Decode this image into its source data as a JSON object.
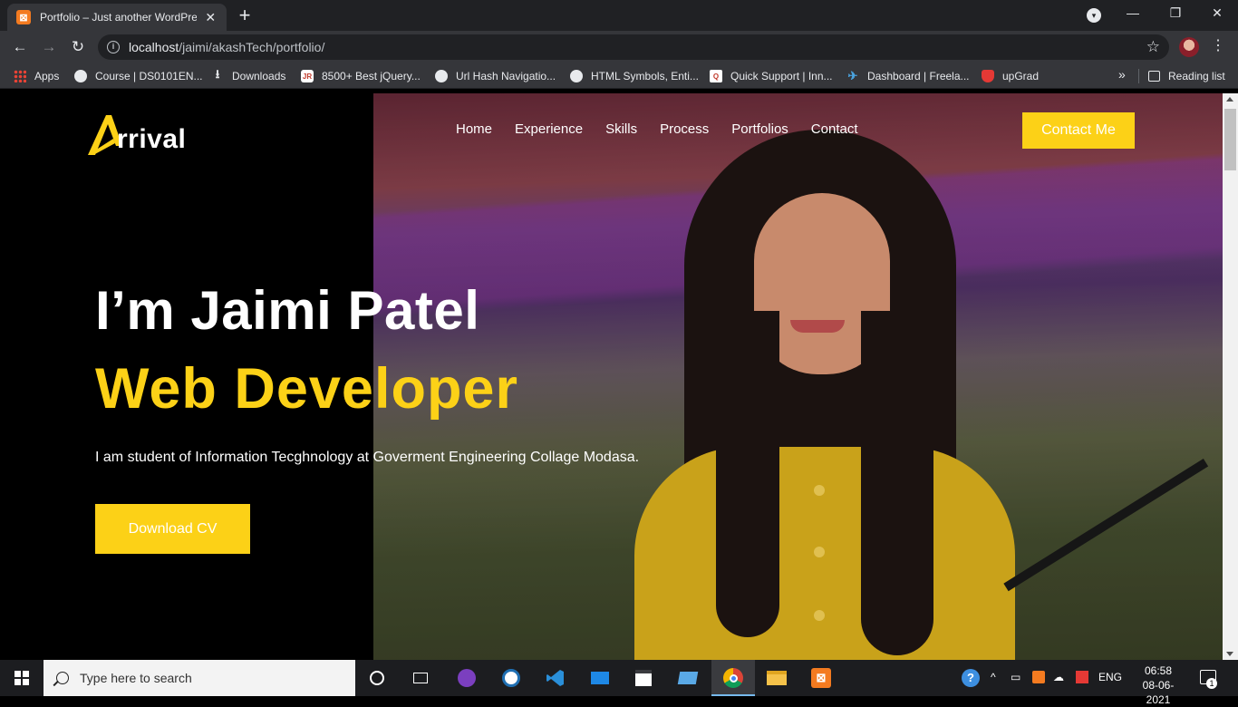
{
  "browser": {
    "tab": {
      "title": "Portfolio – Just another WordPress site",
      "close": "✕",
      "favicon_label": "⊠"
    },
    "new_tab": "+",
    "window": {
      "minimize": "—",
      "maximize": "❐",
      "close": "✕"
    },
    "toolbar": {
      "back": "←",
      "forward": "→",
      "reload": "↻",
      "info": "i",
      "url_host": "localhost",
      "url_path": "/jaimi/akashTech/portfolio/",
      "star": "☆",
      "menu": "⋮"
    },
    "bookmarks": [
      {
        "label": "Apps",
        "icon": "apps-grid-icon"
      },
      {
        "label": "Course | DS0101EN...",
        "icon": "globe-icon"
      },
      {
        "label": "Downloads",
        "icon": "download-icon"
      },
      {
        "label": "8500+ Best jQuery...",
        "icon": "jr-icon"
      },
      {
        "label": "Url Hash Navigatio...",
        "icon": "globe-icon"
      },
      {
        "label": "HTML Symbols, Enti...",
        "icon": "globe-icon"
      },
      {
        "label": "Quick Support | Inn...",
        "icon": "quick-support-icon"
      },
      {
        "label": "Dashboard | Freela...",
        "icon": "bird-icon"
      },
      {
        "label": "upGrad",
        "icon": "upgrad-icon"
      }
    ],
    "bookmarks_more": "»",
    "reading_list": "Reading list"
  },
  "site": {
    "logo_text": "rrival",
    "nav": [
      "Home",
      "Experience",
      "Skills",
      "Process",
      "Portfolios",
      "Contact"
    ],
    "contact_button": "Contact Me",
    "hero": {
      "heading": "I’m Jaimi Patel",
      "subheading": "Web Developer",
      "description": "I am student of Information Tecghnology at Goverment Engineering Collage Modasa.",
      "cv_button": "Download CV"
    },
    "accent_color": "#fcd117"
  },
  "taskbar": {
    "search_placeholder": "Type here to search",
    "language": "ENG",
    "time": "06:58",
    "date": "08-06-2021",
    "notification_count": "1"
  }
}
